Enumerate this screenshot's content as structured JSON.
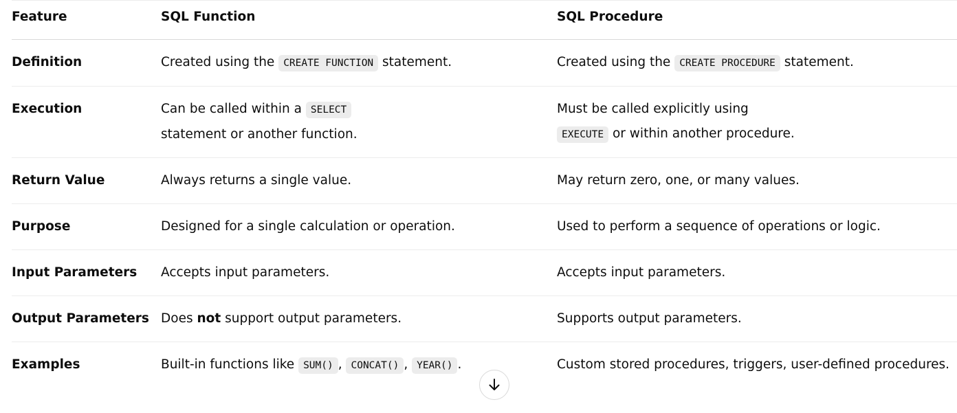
{
  "table": {
    "headers": [
      "Feature",
      "SQL Function",
      "SQL Procedure"
    ],
    "rows": {
      "definition": {
        "feature": "Definition",
        "function": {
          "pre": "Created using the ",
          "code": "CREATE FUNCTION",
          "post": " statement."
        },
        "procedure": {
          "pre": "Created using the ",
          "code": "CREATE PROCEDURE",
          "post": " statement."
        }
      },
      "execution": {
        "feature": "Execution",
        "function": {
          "pre": "Can be called within a ",
          "code": "SELECT",
          "post": "statement or another function."
        },
        "procedure": {
          "pre": "Must be called explicitly using",
          "code": "EXECUTE",
          "post": " or within another procedure."
        }
      },
      "return_value": {
        "feature": "Return Value",
        "function": "Always returns a single value.",
        "procedure": "May return zero, one, or many values."
      },
      "purpose": {
        "feature": "Purpose",
        "function": "Designed for a single calculation or operation.",
        "procedure": "Used to perform a sequence of operations or logic."
      },
      "input_parameters": {
        "feature": "Input Parameters",
        "function": "Accepts input parameters.",
        "procedure": "Accepts input parameters."
      },
      "output_parameters": {
        "feature": "Output Parameters",
        "function": {
          "pre": "Does ",
          "bold": "not",
          "post": " support output parameters."
        },
        "procedure": "Supports output parameters."
      },
      "examples": {
        "feature": "Examples",
        "function": {
          "pre": "Built-in functions like ",
          "codes": [
            "SUM()",
            "CONCAT()",
            "YEAR()"
          ],
          "sep": ", ",
          "post": "."
        },
        "procedure": "Custom stored procedures, triggers, user-defined procedures."
      }
    }
  },
  "scroll_button": {
    "icon": "arrow-down-icon"
  }
}
